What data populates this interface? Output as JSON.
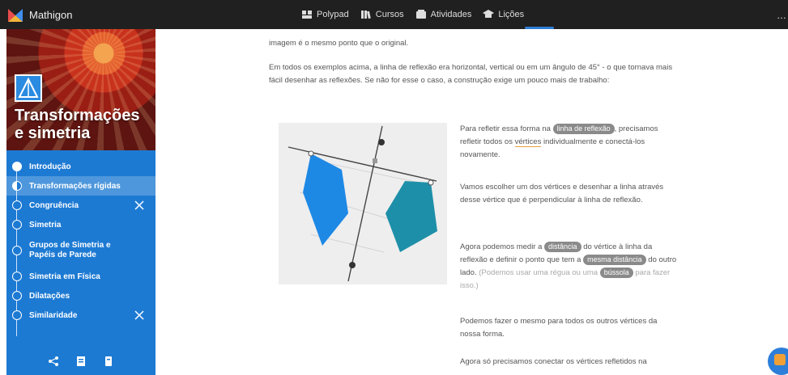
{
  "topbar": {
    "brand": "Mathigon",
    "nav": [
      {
        "label": "Polypad",
        "icon": "polypad-icon"
      },
      {
        "label": "Cursos",
        "icon": "courses-icon"
      },
      {
        "label": "Atividades",
        "icon": "activities-icon"
      },
      {
        "label": "Lições",
        "icon": "lessons-icon"
      }
    ],
    "right_glyph": "…"
  },
  "sidebar": {
    "title": "Transformações e simetria",
    "items": [
      {
        "label": "Introdução",
        "state": "done"
      },
      {
        "label": "Transformações rígidas",
        "state": "active"
      },
      {
        "label": "Congruência",
        "state": "todo",
        "tool": true
      },
      {
        "label": "Simetria",
        "state": "todo"
      },
      {
        "label": "Grupos de Simetria e Papéis de Parede",
        "state": "todo"
      },
      {
        "label": "Simetria em Física",
        "state": "todo"
      },
      {
        "label": "Dilatações",
        "state": "todo"
      },
      {
        "label": "Similaridade",
        "state": "todo",
        "tool": true
      }
    ]
  },
  "content": {
    "p1": "imagem é o mesmo ponto que o original.",
    "p2": "Em todos os exemplos acima, a linha de reflexão era horizontal, vertical ou em um ângulo de 45° - o que tornava mais fácil desenhar as reflexões. Se não for esse o caso, a construção exige um pouco mais de trabalho:",
    "s1_a": "Para refletir essa forma na",
    "s1_pill": "linha de reflexão",
    "s1_b": ", precisamos refletir todos os",
    "s1_vert": "vértices",
    "s1_c": "individualmente e conectá-los novamente.",
    "s2": "Vamos escolher um dos vértices e desenhar a linha através desse vértice que é perpendicular à linha de reflexão.",
    "s3_a": "Agora podemos medir a",
    "s3_pill1": "distância",
    "s3_b": "do vértice à linha da reflexão e definir o ponto que tem a",
    "s3_pill2": "mesma distância",
    "s3_c": "do outro lado.",
    "s3_muted_a": "(Podemos usar uma régua ou uma",
    "s3_pill3": "bússola",
    "s3_muted_b": "para fazer isso.)",
    "s4": "Podemos fazer o mesmo para todos os outros vértices da nossa forma.",
    "s5": "Agora só precisamos conectar os vértices refletidos na"
  },
  "colors": {
    "topbar": "#202020",
    "sidebar": "#1d7ad3",
    "shape_left": "#1e88e5",
    "shape_right": "#1e8fa8",
    "pill": "#8a8a8a",
    "underline": "#e8a23b"
  }
}
